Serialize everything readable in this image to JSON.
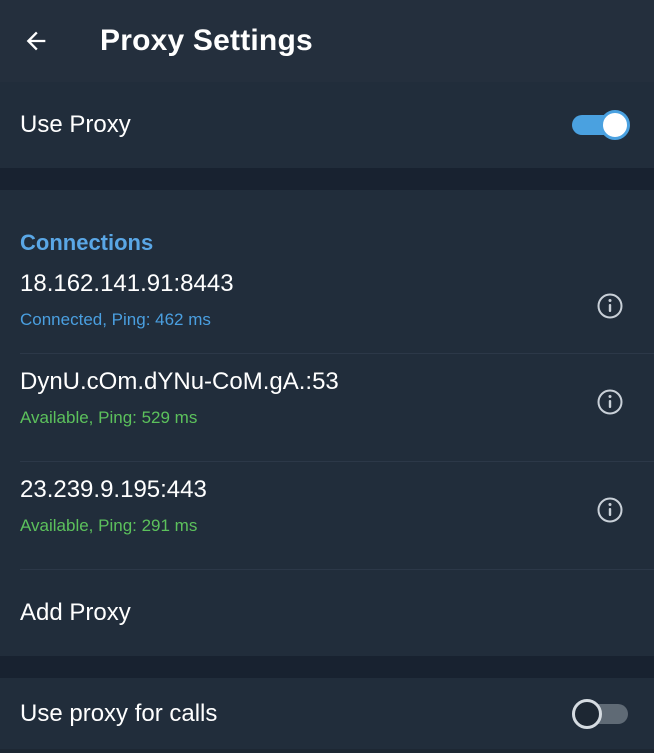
{
  "header": {
    "title": "Proxy Settings",
    "back_icon": "arrow-left-icon"
  },
  "use_proxy": {
    "label": "Use Proxy",
    "enabled": true
  },
  "connections": {
    "title": "Connections",
    "items": [
      {
        "address": "18.162.141.91:8443",
        "status": "Connected, Ping: 462 ms",
        "status_color": "#4a9fe0"
      },
      {
        "address": "DynU.cOm.dYNu-CoM.gA.:53",
        "status": "Available, Ping: 529 ms",
        "status_color": "#5cc15c"
      },
      {
        "address": "23.239.9.195:443",
        "status": "Available, Ping: 291 ms",
        "status_color": "#5cc15c"
      }
    ],
    "add_label": "Add Proxy"
  },
  "use_proxy_calls": {
    "label": "Use proxy for calls",
    "enabled": false
  },
  "colors": {
    "accent": "#4aa1e0",
    "available": "#5cc15c",
    "background": "#1d2733"
  }
}
